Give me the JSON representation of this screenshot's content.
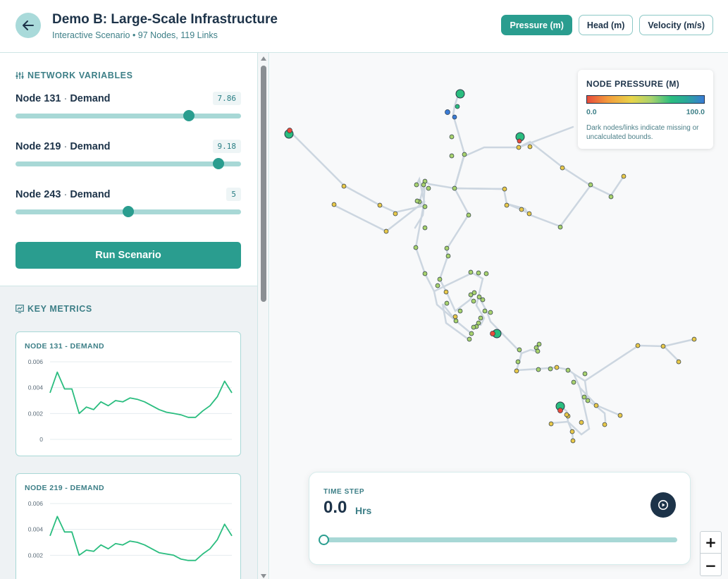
{
  "header": {
    "title": "Demo B: Large-Scale Infrastructure",
    "subtitle": "Interactive Scenario • 97 Nodes, 119 Links",
    "metric_tabs": [
      {
        "label": "Pressure (m)",
        "active": true
      },
      {
        "label": "Head (m)",
        "active": false
      },
      {
        "label": "Velocity (m/s)",
        "active": false
      }
    ]
  },
  "sidebar": {
    "variables_title": "NETWORK VARIABLES",
    "separator": "·",
    "variables": [
      {
        "node": "Node 131",
        "type": "Demand",
        "value": "7.86",
        "fraction": 0.77
      },
      {
        "node": "Node 219",
        "type": "Demand",
        "value": "9.18",
        "fraction": 0.9
      },
      {
        "node": "Node 243",
        "type": "Demand",
        "value": "5",
        "fraction": 0.5
      }
    ],
    "run_button": "Run Scenario",
    "metrics_title": "KEY METRICS"
  },
  "chart_data": [
    {
      "type": "line",
      "title": "NODE 131 - DEMAND",
      "yticks": [
        "0.006",
        "0.004",
        "0.002",
        "0"
      ],
      "ylim": [
        0,
        0.006
      ],
      "x": [
        0,
        1,
        2,
        3,
        4,
        5,
        6,
        7,
        8,
        9,
        10,
        11,
        12,
        13,
        14,
        15,
        16,
        17,
        18,
        19,
        20,
        21,
        22,
        23,
        24,
        25,
        26,
        27
      ],
      "values": [
        0.0036,
        0.0052,
        0.0039,
        0.0039,
        0.002,
        0.0025,
        0.0023,
        0.0029,
        0.0026,
        0.003,
        0.0029,
        0.0032,
        0.0031,
        0.0029,
        0.0026,
        0.0023,
        0.0021,
        0.002,
        0.0019,
        0.0017,
        0.0017,
        0.0022,
        0.0026,
        0.0033,
        0.0045,
        0.0036
      ],
      "color": "#2abd7f"
    },
    {
      "type": "line",
      "title": "NODE 219 - DEMAND",
      "yticks": [
        "0.006",
        "0.004",
        "0.002"
      ],
      "ylim": [
        0,
        0.006
      ],
      "values": [
        0.0035,
        0.005,
        0.0038,
        0.0038,
        0.002,
        0.0024,
        0.0023,
        0.0028,
        0.0025,
        0.0029,
        0.0028,
        0.0031,
        0.003,
        0.0028,
        0.0025,
        0.0022,
        0.0021,
        0.002,
        0.0017,
        0.0016,
        0.0016,
        0.0021,
        0.0025,
        0.0032,
        0.0044,
        0.0035
      ],
      "color": "#2abd7f"
    }
  ],
  "legend": {
    "title": "NODE PRESSURE (M)",
    "min": "0.0",
    "max": "100.0",
    "note": "Dark nodes/links indicate missing or uncalculated bounds."
  },
  "timestep": {
    "label": "TIME STEP",
    "value": "0.0",
    "unit": "Hrs",
    "fraction": 0
  },
  "zoom": {
    "in": "+",
    "out": "−"
  },
  "colors": {
    "accent": "#2a9d8f",
    "navy": "#1d3349",
    "teal_light": "#a8d8d6",
    "link": "#ccd6e0"
  },
  "icons": {
    "back": "arrow-left-icon",
    "variables": "sliders-icon",
    "metrics": "chart-icon",
    "play": "play-icon"
  }
}
